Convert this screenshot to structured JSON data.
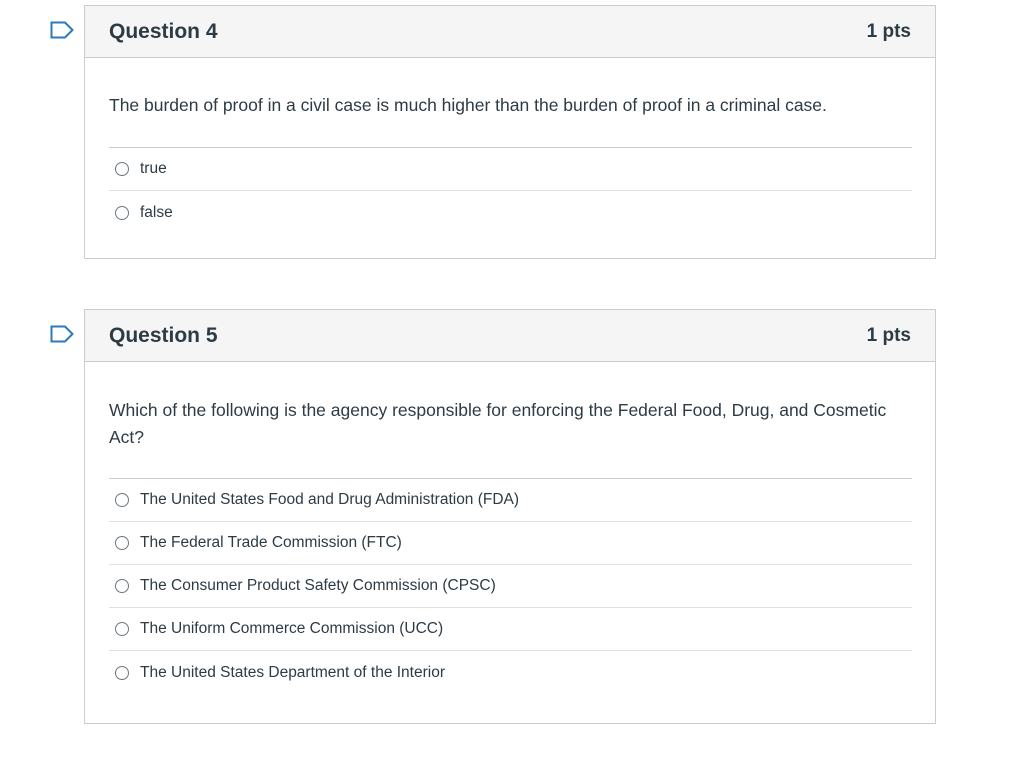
{
  "colors": {
    "header_bg": "#f5f5f5",
    "border": "#c7cdd1",
    "text": "#2d3b45",
    "flag_stroke": "#2b7abc"
  },
  "questions": [
    {
      "title": "Question 4",
      "points": "1 pts",
      "flag_icon": "bookmark-flag-icon",
      "text": "The burden of proof in a civil case is much higher than the burden of proof in a criminal case.",
      "answers": [
        "true",
        "false"
      ]
    },
    {
      "title": "Question 5",
      "points": "1 pts",
      "flag_icon": "bookmark-flag-icon",
      "text": "Which of the following is the agency responsible for enforcing the Federal Food, Drug, and Cosmetic Act?",
      "answers": [
        "The United States Food and Drug Administration (FDA)",
        "The Federal Trade Commission (FTC)",
        "The Consumer Product Safety Commission (CPSC)",
        "The Uniform Commerce Commission (UCC)",
        "The United States Department of the Interior"
      ]
    }
  ]
}
